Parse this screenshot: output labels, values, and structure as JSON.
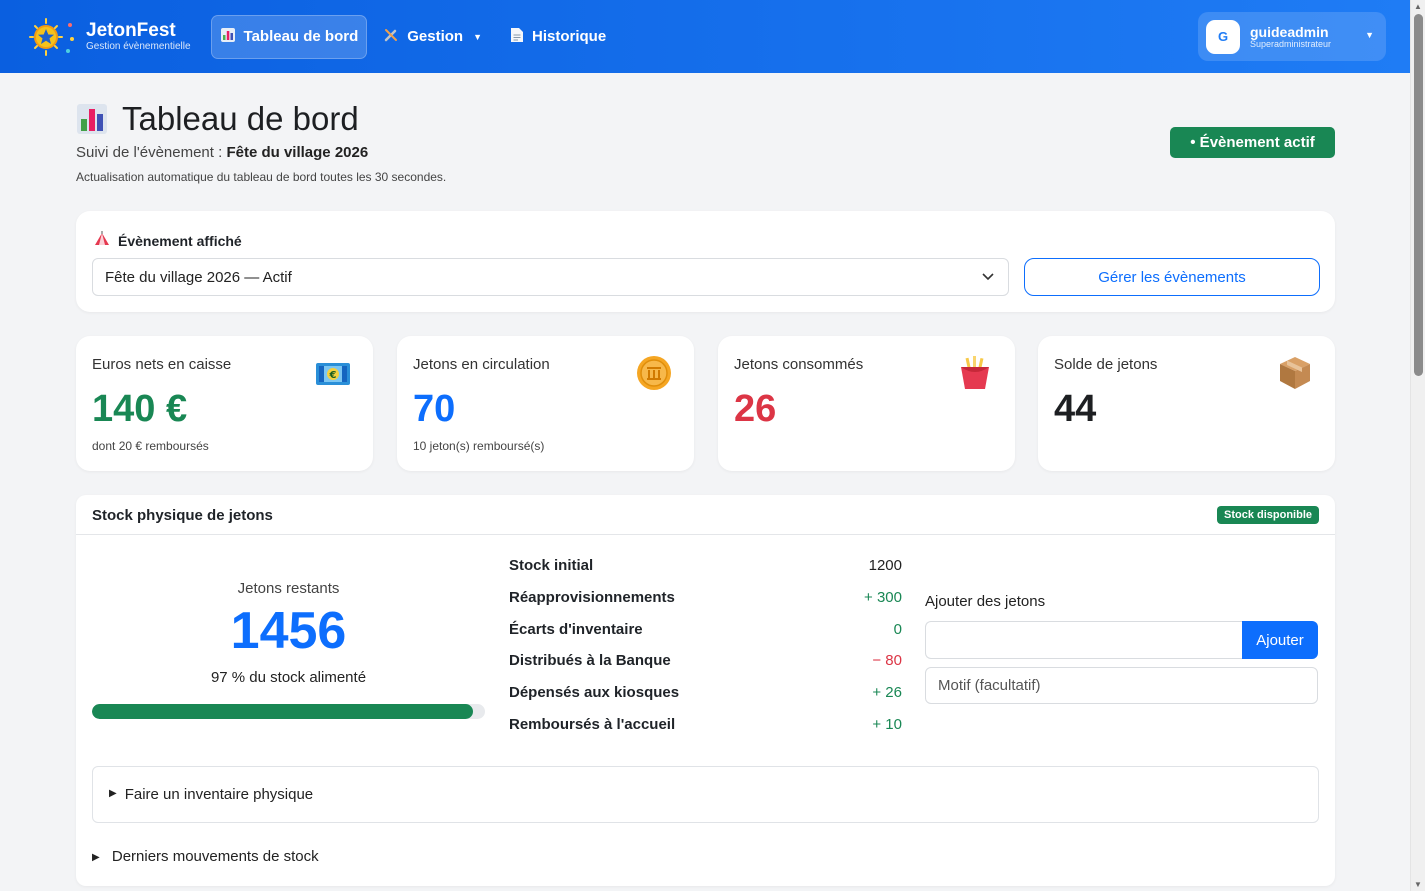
{
  "app": {
    "title": "JetonFest",
    "subtitle": "Gestion évènementielle"
  },
  "nav": {
    "items": [
      {
        "label": "Tableau de bord",
        "icon": "bar-chart-icon",
        "active": true
      },
      {
        "label": "Gestion",
        "icon": "tools-icon",
        "dropdown": true
      },
      {
        "label": "Historique",
        "icon": "document-icon"
      }
    ]
  },
  "user": {
    "initial": "G",
    "name": "guideadmin",
    "role": "Superadministrateur"
  },
  "header": {
    "title": "Tableau de bord",
    "subtitle_prefix": "Suivi de l'évènement : ",
    "event_name": "Fête du village 2026",
    "note": "Actualisation automatique du tableau de bord toutes les 30 secondes.",
    "status_badge": "• Évènement actif"
  },
  "event_picker": {
    "label": "Évènement affiché",
    "selected": "Fête du village 2026 — Actif",
    "manage_button": "Gérer les évènements"
  },
  "stats": [
    {
      "label": "Euros nets en caisse",
      "value": "140 €",
      "sub": "dont 20 € remboursés",
      "color": "#198754",
      "icon": "money-icon"
    },
    {
      "label": "Jetons en circulation",
      "value": "70",
      "sub": "10 jeton(s) remboursé(s)",
      "color": "#0d6efd",
      "icon": "coin-icon"
    },
    {
      "label": "Jetons consommés",
      "value": "26",
      "sub": "",
      "color": "#dc3545",
      "icon": "fries-icon"
    },
    {
      "label": "Solde de jetons",
      "value": "44",
      "sub": "",
      "color": "#1d1f22",
      "icon": "package-icon"
    }
  ],
  "stock": {
    "title": "Stock physique de jetons",
    "badge": "Stock disponible",
    "remaining_label": "Jetons restants",
    "remaining_value": "1456",
    "percent_text": "97 % du stock alimenté",
    "percent": 97,
    "rows": [
      {
        "label": "Stock initial",
        "value": "1200",
        "tone": "neutral"
      },
      {
        "label": "Réapprovisionnements",
        "value": "+ 300",
        "tone": "green"
      },
      {
        "label": "Écarts d'inventaire",
        "value": "0",
        "tone": "green"
      },
      {
        "label": "Distribués à la Banque",
        "value": "− 80",
        "tone": "red"
      },
      {
        "label": "Dépensés aux kiosques",
        "value": "+ 26",
        "tone": "green"
      },
      {
        "label": "Remboursés à l'accueil",
        "value": "+ 10",
        "tone": "green"
      }
    ],
    "add_label": "Ajouter des jetons",
    "add_value": "",
    "add_button": "Ajouter",
    "motif_placeholder": "Motif (facultatif)",
    "inventory_toggle": "Faire un inventaire physique",
    "movements_toggle": "Derniers mouvements de stock"
  },
  "colors": {
    "primary": "#0d6efd",
    "success": "#198754",
    "danger": "#dc3545",
    "navbar": "#1470eb"
  }
}
